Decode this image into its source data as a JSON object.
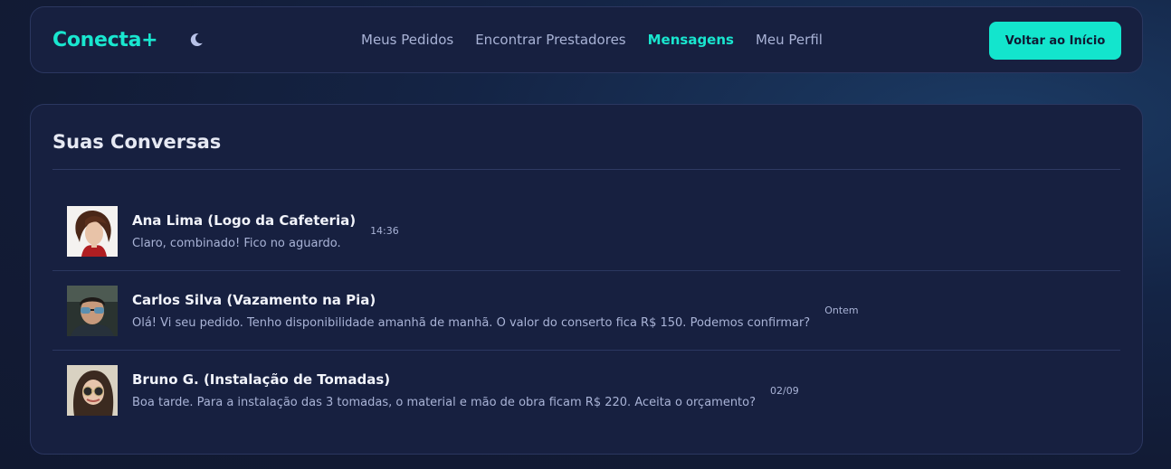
{
  "header": {
    "logo": "Conecta+",
    "theme_icon": "moon-icon",
    "nav": [
      {
        "label": "Meus Pedidos",
        "active": false
      },
      {
        "label": "Encontrar Prestadores",
        "active": false
      },
      {
        "label": "Mensagens",
        "active": true
      },
      {
        "label": "Meu Perfil",
        "active": false
      }
    ],
    "back_button": "Voltar ao Início"
  },
  "main": {
    "title": "Suas Conversas",
    "conversations": [
      {
        "name": "Ana Lima (Logo da Cafeteria)",
        "last_message": "Claro, combinado! Fico no aguardo.",
        "time": "14:36"
      },
      {
        "name": "Carlos Silva (Vazamento na Pia)",
        "last_message": "Olá! Vi seu pedido. Tenho disponibilidade amanhã de manhã. O valor do conserto fica R$ 150. Podemos confirmar?",
        "time": "Ontem"
      },
      {
        "name": "Bruno G. (Instalação de Tomadas)",
        "last_message": "Boa tarde. Para a instalação das 3 tomadas, o material e mão de obra ficam R$ 220. Aceita o orçamento?",
        "time": "02/09"
      }
    ]
  },
  "colors": {
    "accent": "#19e6cf",
    "background": "#121b35",
    "card": "#172040",
    "muted_text": "#a9b3d6"
  }
}
